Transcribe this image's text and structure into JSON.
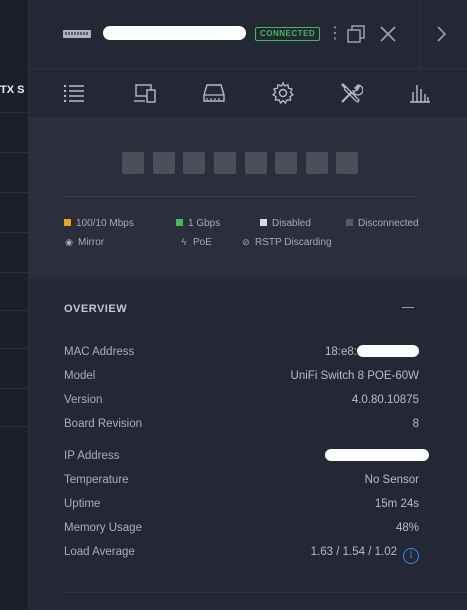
{
  "background_table": {
    "header_text": "TX S",
    "rows": 8
  },
  "header": {
    "device_name": "",
    "status_badge": "CONNECTED"
  },
  "tabs": [
    {
      "name": "details-tab",
      "icon": "list-icon"
    },
    {
      "name": "clients-tab",
      "icon": "devices-icon"
    },
    {
      "name": "ports-tab",
      "icon": "switch-ports-icon"
    },
    {
      "name": "config-tab",
      "icon": "gear-icon"
    },
    {
      "name": "tools-tab",
      "icon": "tools-icon"
    },
    {
      "name": "stats-tab",
      "icon": "bar-chart-icon"
    }
  ],
  "ports": {
    "count": 8,
    "color": "#4a4f5a"
  },
  "legend": {
    "fast": "100/10 Mbps",
    "gig": "1 Gbps",
    "disabled": "Disabled",
    "disconnected": "Disconnected",
    "mirror": "Mirror",
    "poe": "PoE",
    "rstp": "RSTP Discarding",
    "colors": {
      "fast": "#f0a020",
      "gig": "#3dbb5e",
      "disabled": "#d8dbe2",
      "disconnected": "#555a66"
    }
  },
  "overview": {
    "title": "OVERVIEW",
    "props": [
      {
        "key": "MAC Address",
        "value": "18:e8:"
      },
      {
        "key": "Model",
        "value": "UniFi Switch 8 POE-60W"
      },
      {
        "key": "Version",
        "value": "4.0.80.10875"
      },
      {
        "key": "Board Revision",
        "value": "8"
      },
      {
        "key": "IP Address",
        "value": ""
      },
      {
        "key": "Temperature",
        "value": "No Sensor"
      },
      {
        "key": "Uptime",
        "value": "15m 24s"
      },
      {
        "key": "Memory Usage",
        "value": "48%"
      },
      {
        "key": "Load Average",
        "value": "1.63 / 1.54 / 1.02"
      }
    ]
  }
}
